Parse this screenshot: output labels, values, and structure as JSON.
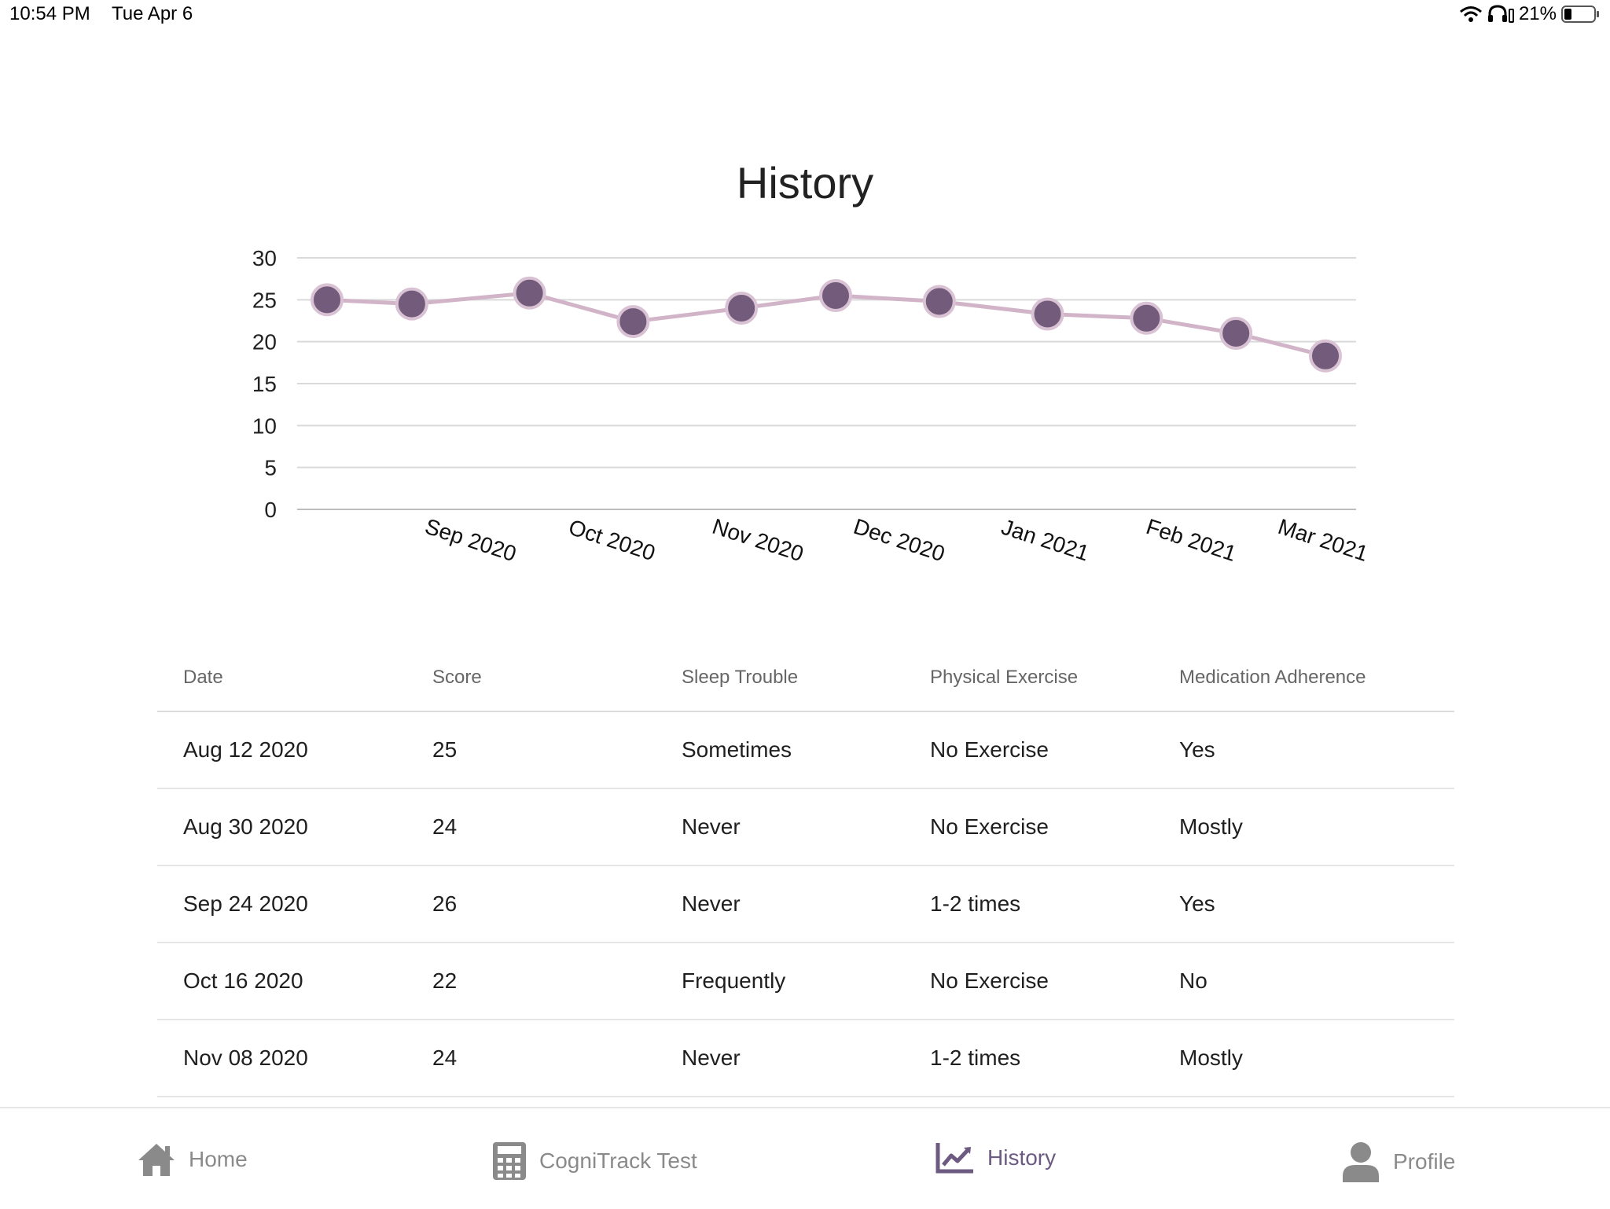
{
  "status_bar": {
    "time": "10:54 PM",
    "date": "Tue Apr 6",
    "battery": "21%"
  },
  "page": {
    "title": "History"
  },
  "chart_data": {
    "type": "line",
    "ylim": [
      0,
      30
    ],
    "yticks": [
      30,
      25,
      20,
      15,
      10,
      5,
      0
    ],
    "xlabels": [
      "Sep 2020",
      "Oct 2020",
      "Nov 2020",
      "Dec 2020",
      "Jan 2021",
      "Feb 2021",
      "Mar 2021"
    ],
    "points": [
      {
        "date": "2020-08-12",
        "score": 25
      },
      {
        "date": "2020-08-30",
        "score": 24.5
      },
      {
        "date": "2020-09-24",
        "score": 25.8
      },
      {
        "date": "2020-10-16",
        "score": 22.4
      },
      {
        "date": "2020-11-08",
        "score": 24
      },
      {
        "date": "2020-11-28",
        "score": 25.5
      },
      {
        "date": "2020-12-20",
        "score": 24.8
      },
      {
        "date": "2021-01-12",
        "score": 23.3
      },
      {
        "date": "2021-02-02",
        "score": 22.8
      },
      {
        "date": "2021-02-21",
        "score": 21
      },
      {
        "date": "2021-03-12",
        "score": 18.3
      }
    ],
    "line_color": "#d2b4c9",
    "marker_color": "#725b7b",
    "marker_stroke": "#d9c2d3",
    "grid": true
  },
  "table": {
    "headers": [
      "Date",
      "Score",
      "Sleep Trouble",
      "Physical Exercise",
      "Medication Adherence"
    ],
    "rows": [
      [
        "Aug 12 2020",
        "25",
        "Sometimes",
        "No Exercise",
        "Yes"
      ],
      [
        "Aug 30 2020",
        "24",
        "Never",
        "No Exercise",
        "Mostly"
      ],
      [
        "Sep 24 2020",
        "26",
        "Never",
        "1-2 times",
        "Yes"
      ],
      [
        "Oct 16 2020",
        "22",
        "Frequently",
        "No Exercise",
        "No"
      ],
      [
        "Nov 08 2020",
        "24",
        "Never",
        "1-2 times",
        "Mostly"
      ]
    ]
  },
  "nav": {
    "home": "Home",
    "test": "CogniTrack Test",
    "history": "History",
    "profile": "Profile",
    "active_color": "#6c5a80",
    "inactive_color": "#8a8a8a",
    "icons": [
      "home-icon",
      "calculator-icon",
      "chart-line-icon",
      "person-icon"
    ]
  }
}
